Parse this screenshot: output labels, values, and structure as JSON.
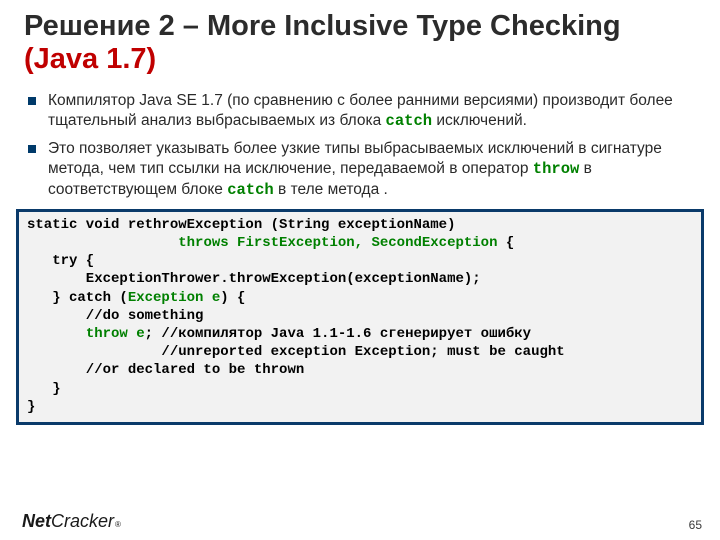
{
  "title": {
    "dark": "Решение 2 – More Inclusive Type Checking ",
    "red": "(Java 1.7)"
  },
  "bullets": [
    {
      "pre": "Компилятор Java SE 1.7 (по сравнению с более ранними версиями) производит более тщательный анализ выбрасываемых из блока ",
      "code1": "catch",
      "post": " исключений."
    },
    {
      "pre": "Это позволяет указывать более узкие типы выбрасываемых исключений в сигнатуре метода, чем тип ссылки на исключение, передаваемой в оператор ",
      "code1": "throw",
      "mid": " в соответствующем блоке ",
      "code2": "catch",
      "post": " в теле метода ."
    }
  ],
  "code": {
    "l1a": "static void rethrowException (String exceptionName)",
    "l2a": "                  ",
    "l2g": "throws FirstException, SecondException",
    "l2b": " {",
    "l3": "   try {",
    "l4": "       ExceptionThrower.throwException(exceptionName);",
    "l5a": "   } catch (",
    "l5g": "Exception e",
    "l5b": ") {",
    "l6": "       //do something",
    "l7a": "       ",
    "l7g": "throw e",
    "l7b": "; //компилятор Java 1.1-1.6 сгенерирует ошибку",
    "l8": "                //unreported exception Exception; must be caught",
    "l9": "       //or declared to be thrown",
    "l10": "   }",
    "l11": "}"
  },
  "footer": {
    "logo_net": "Net",
    "logo_cracker": "Cracker",
    "logo_reg": "®",
    "page": "65"
  }
}
